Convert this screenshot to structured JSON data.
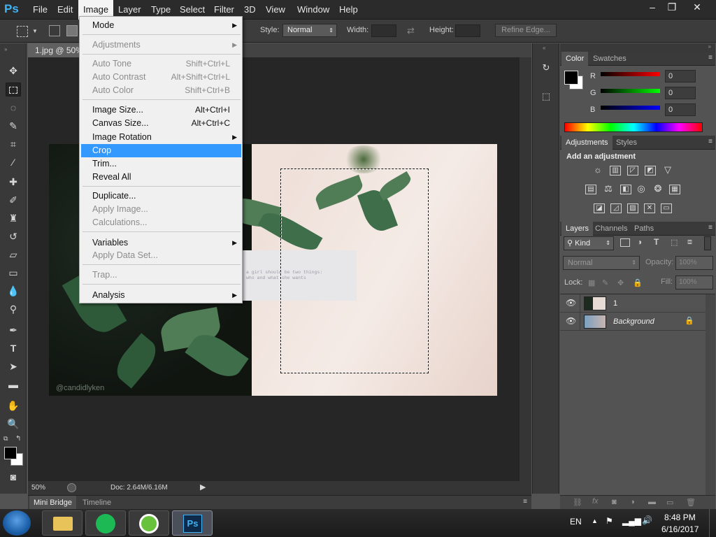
{
  "app": {
    "logo": "Ps",
    "name": "Photoshop"
  },
  "menubar": {
    "items": [
      "File",
      "Edit",
      "Image",
      "Layer",
      "Type",
      "Select",
      "Filter",
      "3D",
      "View",
      "Window",
      "Help"
    ],
    "active": "Image"
  },
  "window_controls": {
    "minimize": "–",
    "restore": "❐",
    "close": "✕"
  },
  "options_bar": {
    "style_label": "Style:",
    "style_value": "Normal",
    "width_label": "Width:",
    "height_label": "Height:",
    "refine_edge": "Refine Edge..."
  },
  "document": {
    "tab_title": "1.jpg @ 50%",
    "zoom": "50%",
    "doc_size": "Doc: 2.64M/6.16M",
    "card_text_line1": "a girl should be two things:",
    "card_text_line2": "who and what she wants",
    "watermark": "@candidlyken"
  },
  "image_menu": {
    "items": [
      {
        "label": "Mode",
        "submenu": true,
        "enabled": true
      },
      {
        "sep": true
      },
      {
        "label": "Adjustments",
        "submenu": true,
        "enabled": false
      },
      {
        "sep": true
      },
      {
        "label": "Auto Tone",
        "shortcut": "Shift+Ctrl+L",
        "enabled": false
      },
      {
        "label": "Auto Contrast",
        "shortcut": "Alt+Shift+Ctrl+L",
        "enabled": false
      },
      {
        "label": "Auto Color",
        "shortcut": "Shift+Ctrl+B",
        "enabled": false
      },
      {
        "sep": true
      },
      {
        "label": "Image Size...",
        "shortcut": "Alt+Ctrl+I",
        "enabled": true
      },
      {
        "label": "Canvas Size...",
        "shortcut": "Alt+Ctrl+C",
        "enabled": true
      },
      {
        "label": "Image Rotation",
        "submenu": true,
        "enabled": true
      },
      {
        "label": "Crop",
        "enabled": true,
        "highlighted": true
      },
      {
        "label": "Trim...",
        "enabled": true
      },
      {
        "label": "Reveal All",
        "enabled": true
      },
      {
        "sep": true
      },
      {
        "label": "Duplicate...",
        "enabled": true
      },
      {
        "label": "Apply Image...",
        "enabled": false
      },
      {
        "label": "Calculations...",
        "enabled": false
      },
      {
        "sep": true
      },
      {
        "label": "Variables",
        "submenu": true,
        "enabled": true
      },
      {
        "label": "Apply Data Set...",
        "enabled": false
      },
      {
        "sep": true
      },
      {
        "label": "Trap...",
        "enabled": false
      },
      {
        "sep": true
      },
      {
        "label": "Analysis",
        "submenu": true,
        "enabled": true
      }
    ]
  },
  "color_panel": {
    "tabs": [
      "Color",
      "Swatches"
    ],
    "r_label": "R",
    "g_label": "G",
    "b_label": "B",
    "r": "0",
    "g": "0",
    "b": "0"
  },
  "adjustments_panel": {
    "tabs": [
      "Adjustments",
      "Styles"
    ],
    "heading": "Add an adjustment"
  },
  "layers_panel": {
    "tabs": [
      "Layers",
      "Channels",
      "Paths"
    ],
    "kind": "Kind",
    "blend_mode": "Normal",
    "opacity_label": "Opacity:",
    "opacity": "100%",
    "lock_label": "Lock:",
    "fill_label": "Fill:",
    "fill": "100%",
    "layers": [
      {
        "name": "1",
        "italic": false
      },
      {
        "name": "Background",
        "italic": true
      }
    ]
  },
  "bottom_tabs": [
    "Mini Bridge",
    "Timeline"
  ],
  "taskbar": {
    "lang": "EN",
    "time": "8:48 PM",
    "date": "6/16/2017",
    "ps_label": "Ps"
  },
  "colors": {
    "accent": "#3399ff",
    "ps_blue": "#3fb3f4",
    "menu_bg": "#f0f0f0",
    "panel_bg": "#535353"
  }
}
